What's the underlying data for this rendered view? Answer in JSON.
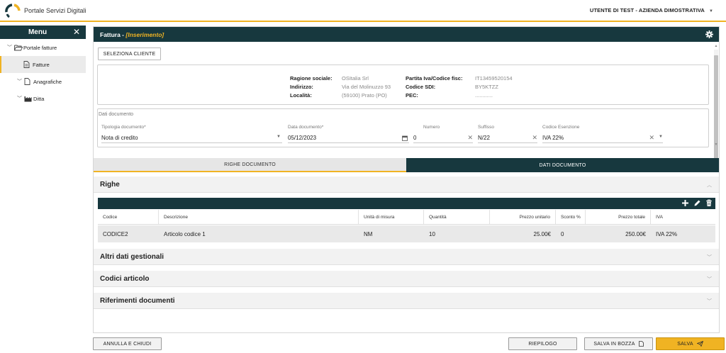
{
  "header": {
    "app_title": "Portale Servizi Digitali",
    "user": "UTENTE DI TEST - AZIENDA DIMOSTRATIVA",
    "accent_color": "#f0b323",
    "dark_color": "#17383e"
  },
  "sidebar": {
    "title": "Menu",
    "items": [
      {
        "label": "Portale fatture",
        "icon": "folder-open-icon"
      },
      {
        "label": "Fatture",
        "icon": "document-icon",
        "active": true
      },
      {
        "label": "Anagrafiche",
        "icon": "file-icon"
      },
      {
        "label": "Ditta",
        "icon": "factory-icon"
      }
    ]
  },
  "panel": {
    "title": "Fattura - ",
    "mode": "[Inserimento]",
    "select_client_label": "SELEZIONA CLIENTE"
  },
  "client": {
    "ragione_sociale_label": "Ragione sociale:",
    "ragione_sociale": "OSItalia Srl",
    "indirizzo_label": "Indirizzo:",
    "indirizzo": "Via del Molinuzzo 93",
    "localita_label": "Località:",
    "localita": "(59100) Prato (PO)",
    "piva_label": "Partita Iva/Codice fisc:",
    "piva": "IT13459520154",
    "sdi_label": "Codice SDI:",
    "sdi": "BY5KTZZ",
    "pec_label": "PEC:",
    "pec": "............"
  },
  "document": {
    "legend": "Dati documento",
    "tipologia_label": "Tipologia documento*",
    "tipologia": "Nota di credito",
    "data_label": "Data documento*",
    "data": "05/12/2023",
    "numero_label": "Numero",
    "numero": "0",
    "suffisso_label": "Suffisso",
    "suffisso": "N/22",
    "esenzione_label": "Codice Esenzione",
    "esenzione": "IVA 22%"
  },
  "tabs": [
    {
      "label": "RIGHE DOCUMENTO",
      "active": true
    },
    {
      "label": "DATI DOCUMENTO",
      "active": false
    }
  ],
  "sections": {
    "righe": "Righe",
    "altri": "Altri dati gestionali",
    "codici": "Codici articolo",
    "riferimenti": "Riferimenti documenti"
  },
  "grid": {
    "columns": [
      "Codice",
      "Descrizione",
      "Unità di misura",
      "Quantità",
      "Prezzo unitario",
      "Sconto %",
      "Prezzo totale",
      "IVA"
    ],
    "rows": [
      [
        "CODICE2",
        "Articolo codice 1",
        "NM",
        "10",
        "25.00€",
        "0",
        "250.00€",
        "IVA 22%"
      ]
    ]
  },
  "footer": {
    "cancel": "ANNULLA E CHIUDI",
    "riepilogo": "RIEPILOGO",
    "draft": "SALVA IN BOZZA",
    "save": "SALVA"
  }
}
